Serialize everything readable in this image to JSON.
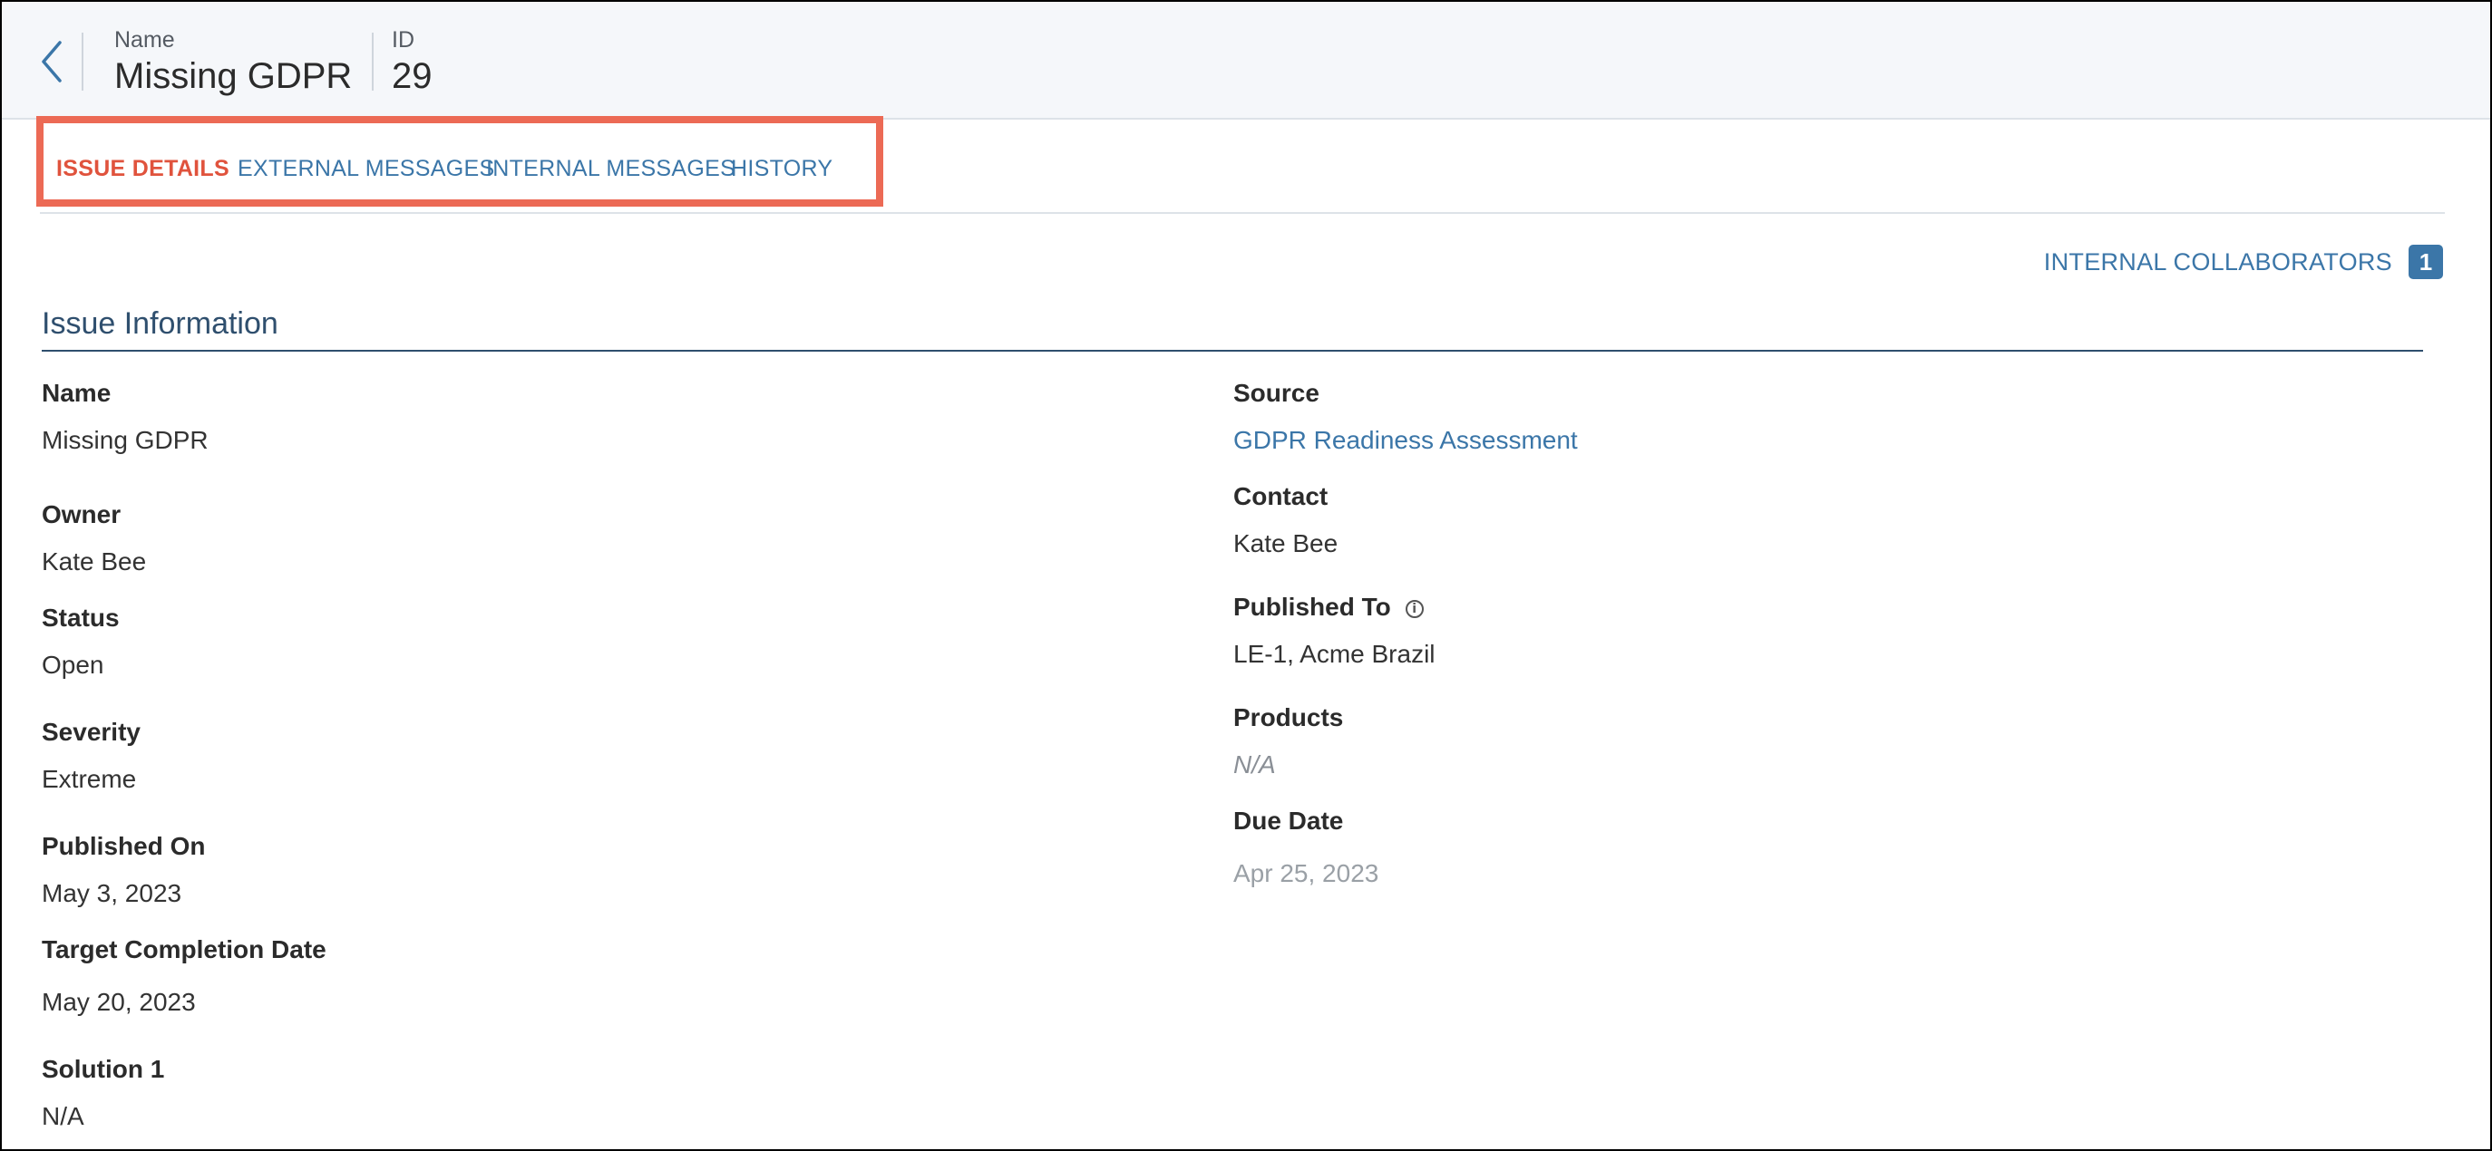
{
  "header": {
    "name_label": "Name",
    "name_value": "Missing GDPR",
    "id_label": "ID",
    "id_value": "29"
  },
  "tabs": [
    {
      "label": "ISSUE DETAILS",
      "active": true
    },
    {
      "label": "EXTERNAL MESSAGES",
      "active": false
    },
    {
      "label": "INTERNAL MESSAGES",
      "active": false
    },
    {
      "label": "HISTORY",
      "active": false
    }
  ],
  "collaborators": {
    "label": "INTERNAL COLLABORATORS",
    "count": "1"
  },
  "section": {
    "title": "Issue Information"
  },
  "left_fields": [
    {
      "label": "Name",
      "value": "Missing GDPR"
    },
    {
      "label": "Owner",
      "value": "Kate Bee"
    },
    {
      "label": "Status",
      "value": "Open"
    },
    {
      "label": "Severity",
      "value": "Extreme"
    },
    {
      "label": "Published On",
      "value": "May 3, 2023"
    },
    {
      "label": "Target Completion Date",
      "value": "May 20, 2023"
    },
    {
      "label": "Solution 1",
      "value": "N/A"
    }
  ],
  "right_fields": [
    {
      "label": "Source",
      "value": "GDPR Readiness Assessment"
    },
    {
      "label": "Contact",
      "value": "Kate Bee"
    },
    {
      "label": "Published To",
      "value": "LE-1, Acme Brazil"
    },
    {
      "label": "Products",
      "value": "N/A"
    },
    {
      "label": "Due Date",
      "value": "Apr 25, 2023"
    }
  ],
  "colors": {
    "accent": "#3b76a8",
    "active_tab": "#e0533d",
    "highlight": "#ec6a55"
  }
}
